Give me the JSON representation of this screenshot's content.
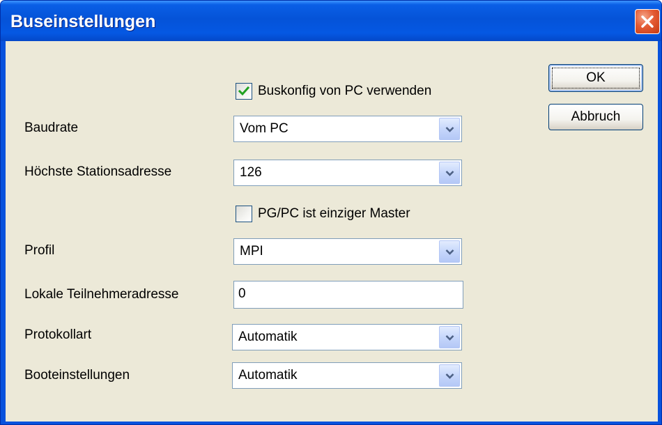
{
  "window": {
    "title": "Buseinstellungen",
    "colors": {
      "titlebar": "#0553D8",
      "client": "#ECE9D8",
      "close": "#E45B33"
    }
  },
  "options": {
    "use_pc_busconfig": {
      "label": "Buskonfig von PC verwenden",
      "checked": true
    },
    "only_master": {
      "label": "PG/PC ist einziger Master",
      "checked": false
    }
  },
  "fields": {
    "baudrate": {
      "label": "Baudrate",
      "value": "Vom PC"
    },
    "highest_station": {
      "label": "Höchste Stationsadresse",
      "value": "126"
    },
    "profile": {
      "label": "Profil",
      "value": "MPI"
    },
    "local_address": {
      "label": "Lokale Teilnehmeradresse",
      "value": "0"
    },
    "protocol": {
      "label": "Protokollart",
      "value": "Automatik"
    },
    "boot": {
      "label": "Booteinstellungen",
      "value": "Automatik"
    }
  },
  "buttons": {
    "ok": "OK",
    "cancel": "Abbruch"
  },
  "icons": {
    "close": "close-icon",
    "dropdown": "chevron-down-icon",
    "check": "checkmark-icon"
  }
}
